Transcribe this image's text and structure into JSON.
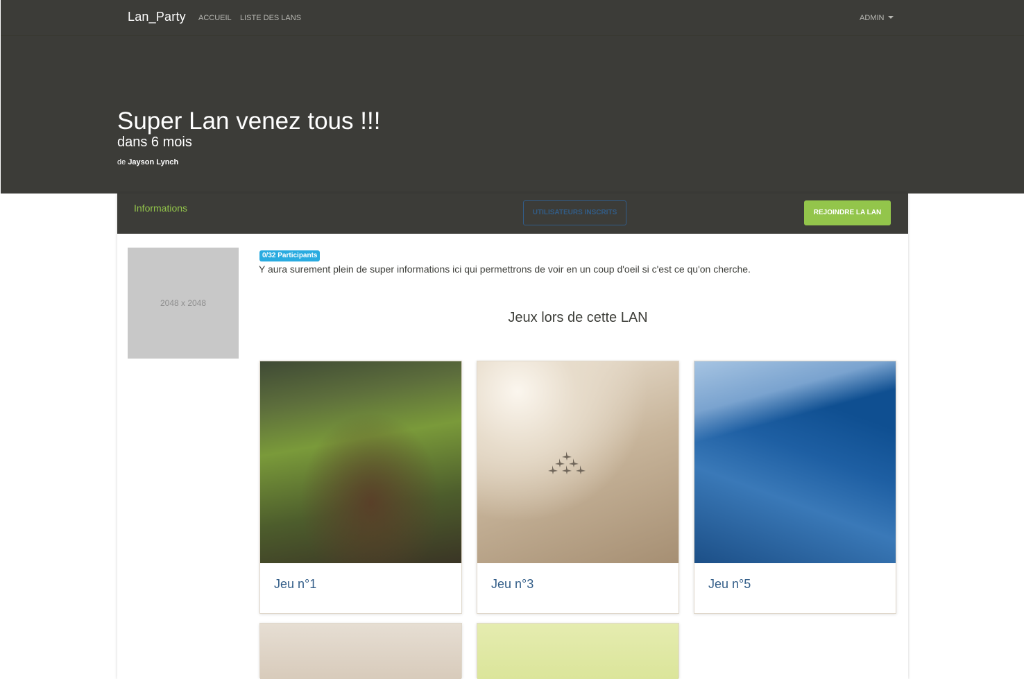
{
  "navbar": {
    "brand": "Lan_Party",
    "links": [
      "ACCUEIL",
      "LISTE DES LANS"
    ],
    "user_menu": "ADMIN"
  },
  "hero": {
    "title": "Super Lan venez tous !!!",
    "subtitle": "dans 6 mois",
    "author_prefix": "de",
    "author_name": "Jayson Lynch"
  },
  "tabs": {
    "informations": "Informations",
    "users_button": "UTILISATEURS INSCRITS",
    "join_button": "REJOINDRE LA LAN"
  },
  "lan": {
    "image_placeholder": "2048 x 2048",
    "participants_badge": "0/32 Participants",
    "description": "Y aura surement plein de super informations ici qui permettrons de voir en un coup d'oeil si c'est ce qu'on cherche."
  },
  "games": {
    "section_title": "Jeux lors de cette LAN",
    "cards": [
      {
        "title": "Jeu n°1"
      },
      {
        "title": "Jeu n°3"
      },
      {
        "title": "Jeu n°5"
      },
      {
        "title": ""
      },
      {
        "title": ""
      }
    ]
  },
  "colors": {
    "dark_bg": "#3c3c38",
    "accent_green": "#93c54b",
    "primary_blue": "#325d88",
    "badge_info": "#29abe0"
  }
}
